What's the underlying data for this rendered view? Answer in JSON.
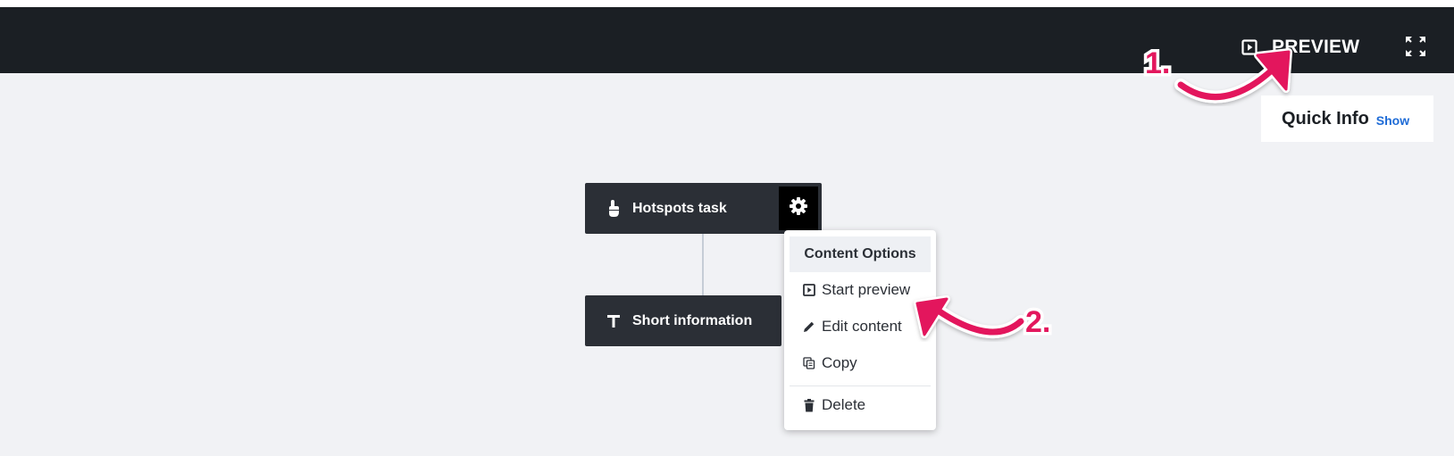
{
  "header": {
    "preview_label": "PREVIEW",
    "preview_icon": "play-square-icon",
    "fullscreen_icon": "fullscreen-icon",
    "background": "#1b1f24"
  },
  "quick_info": {
    "title": "Quick Info",
    "toggle_label": "Show",
    "link_color": "#1e6bd6"
  },
  "nodes": [
    {
      "label": "Hotspots task",
      "icon": "hand-pointer-icon"
    },
    {
      "label": "Short information",
      "icon": "text-icon"
    }
  ],
  "content_menu": {
    "header": "Content Options",
    "items": [
      {
        "label": "Start preview",
        "icon": "play-square-icon"
      },
      {
        "label": "Edit content",
        "icon": "pencil-icon"
      },
      {
        "label": "Copy",
        "icon": "copy-icon"
      },
      {
        "label": "Delete",
        "icon": "trash-icon"
      }
    ]
  },
  "annotations": {
    "step1": "1.",
    "step2": "2.",
    "color": "#e3175d"
  }
}
